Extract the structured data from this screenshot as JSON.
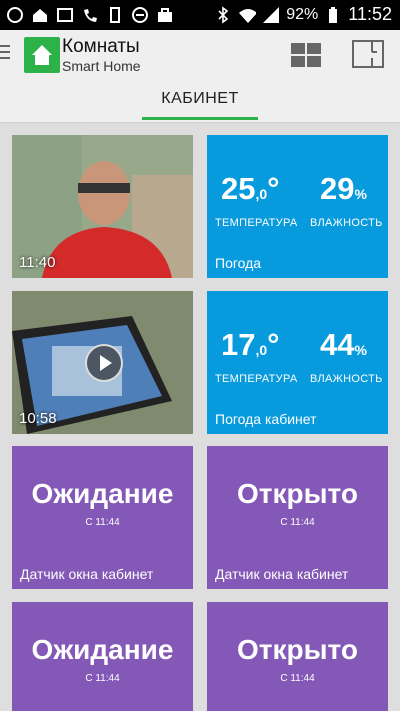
{
  "status": {
    "battery": "92%",
    "time": "11:52"
  },
  "app": {
    "title": "Комнаты",
    "subtitle": "Smart Home"
  },
  "tab": {
    "label": "КАБИНЕТ"
  },
  "cameras": [
    {
      "time": "11:40"
    },
    {
      "time": "10:58"
    }
  ],
  "weather": [
    {
      "temp_int": "25",
      "temp_dec": ",0",
      "temp_unit": "°",
      "temp_label": "ТЕМПЕРАТУРА",
      "hum": "29",
      "hum_unit": "%",
      "hum_label": "ВЛАЖНОСТЬ",
      "name": "Погода"
    },
    {
      "temp_int": "17",
      "temp_dec": ",0",
      "temp_unit": "°",
      "temp_label": "ТЕМПЕРАТУРА",
      "hum": "44",
      "hum_unit": "%",
      "hum_label": "ВЛАЖНОСТЬ",
      "name": "Погода кабинет"
    }
  ],
  "sensors": [
    {
      "state": "Ожидание",
      "since": "С 11:44",
      "name": "Датчик окна кабинет"
    },
    {
      "state": "Открыто",
      "since": "С 11:44",
      "name": "Датчик окна кабинет"
    },
    {
      "state": "Ожидание",
      "since": "С 11:44",
      "name": ""
    },
    {
      "state": "Открыто",
      "since": "С 11:44",
      "name": ""
    }
  ],
  "colors": {
    "accent": "#2db24a",
    "weather_tile": "#079bde",
    "sensor_tile": "#8458b6"
  }
}
